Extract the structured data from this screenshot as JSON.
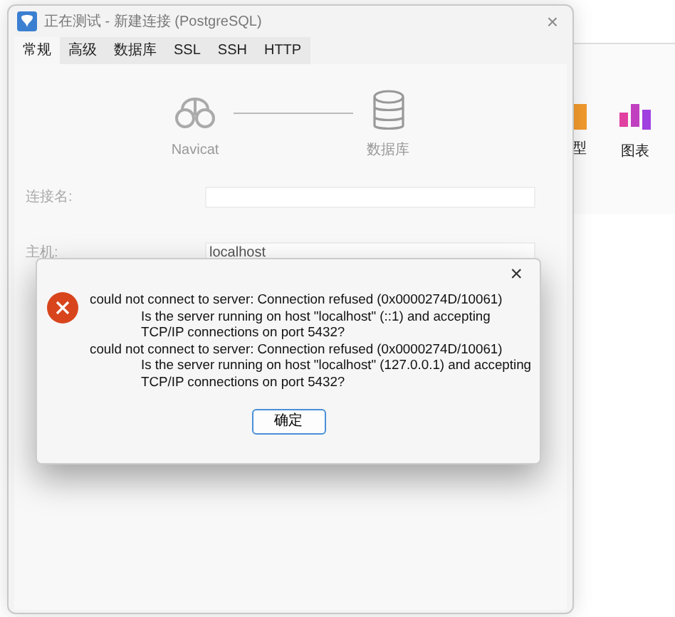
{
  "background_app": {
    "toolbar": [
      {
        "label": "型",
        "kind": "model"
      },
      {
        "label": "图表",
        "kind": "chart"
      }
    ]
  },
  "window": {
    "title": "正在测试 - 新建连接 (PostgreSQL)",
    "close": "×"
  },
  "tabs": [
    {
      "label": "常规",
      "selected": true
    },
    {
      "label": "高级",
      "selected": false
    },
    {
      "label": "数据库",
      "selected": false
    },
    {
      "label": "SSL",
      "selected": false
    },
    {
      "label": "SSH",
      "selected": false
    },
    {
      "label": "HTTP",
      "selected": false
    }
  ],
  "diagram": {
    "left_label": "Navicat",
    "right_label": "数据库"
  },
  "fields": [
    {
      "label": "连接名:"
    },
    {
      "label": "主机:",
      "value": "localhost"
    }
  ],
  "error_dialog": {
    "close": "×",
    "lines": [
      {
        "text": "could not connect to server: Connection refused (0x0000274D/10061)",
        "kind": "message"
      },
      {
        "text": "Is the server running on host \"localhost\" (::1) and accepting",
        "kind": "detail"
      },
      {
        "text": "TCP/IP connections on port 5432?",
        "kind": "detail"
      },
      {
        "text": "could not connect to server: Connection refused (0x0000274D/10061)",
        "kind": "message"
      },
      {
        "text": "Is the server running on host \"localhost\" (127.0.0.1) and accepting",
        "kind": "detail"
      },
      {
        "text": "TCP/IP connections on port 5432?",
        "kind": "detail"
      }
    ],
    "button": "确定"
  }
}
